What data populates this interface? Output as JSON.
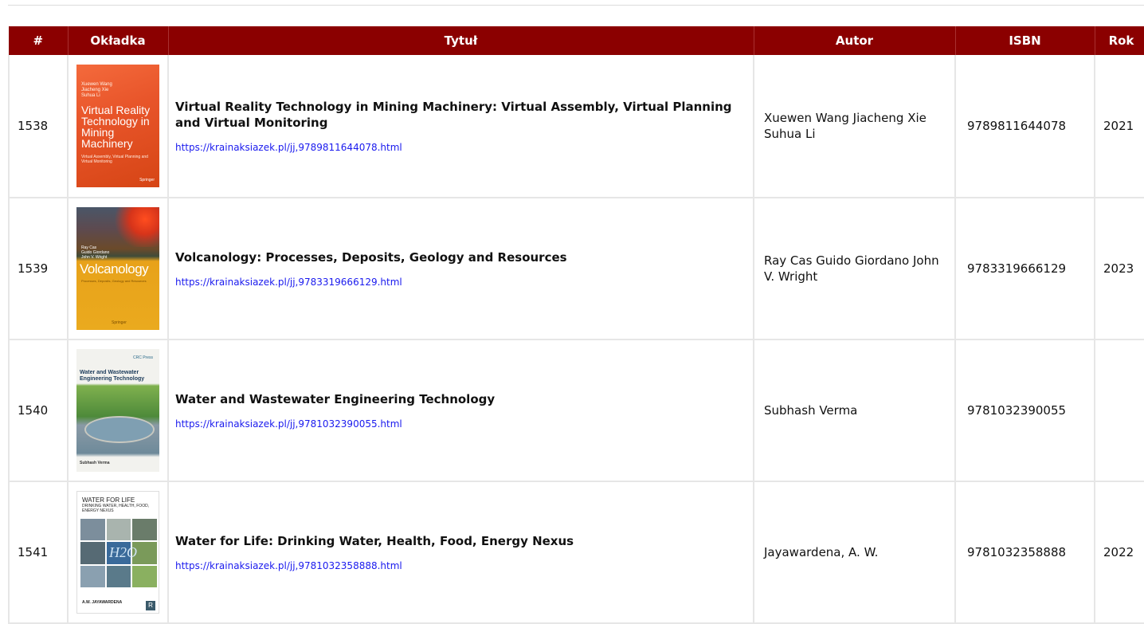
{
  "table": {
    "headers": [
      "#",
      "Okładka",
      "Tytuł",
      "Autor",
      "ISBN",
      "Rok"
    ],
    "rows": [
      {
        "num": "1538",
        "title": "Virtual Reality Technology in Mining Machinery: Virtual Assembly, Virtual Planning and Virtual Monitoring",
        "link": "https://krainaksiazek.pl/jj,9789811644078.html",
        "author": "Xuewen Wang Jiacheng Xie Suhua Li",
        "isbn": "9789811644078",
        "year": "2021",
        "cover": {
          "authors": "Xuewen Wang\nJiacheng Xie\nSuhua Li",
          "title": "Virtual Reality Technology in Mining Machinery",
          "subtitle": "Virtual Assembly, Virtual Planning and Virtual Monitoring",
          "publisher": "Springer"
        }
      },
      {
        "num": "1539",
        "title": "Volcanology: Processes, Deposits, Geology and Resources",
        "link": "https://krainaksiazek.pl/jj,9783319666129.html",
        "author": "Ray Cas Guido Giordano John V. Wright",
        "isbn": "9783319666129",
        "year": "2023",
        "cover": {
          "authors": "Ray Cas\nGuido Giordano\nJohn V. Wright",
          "title": "Volcanology",
          "subtitle": "Processes, Deposits, Geology and Resources",
          "publisher": "Springer"
        }
      },
      {
        "num": "1540",
        "title": "Water and Wastewater Engineering Technology",
        "link": "https://krainaksiazek.pl/jj,9781032390055.html",
        "author": "Subhash Verma",
        "isbn": "9781032390055",
        "year": "",
        "cover": {
          "logo": "CRC Press",
          "title": "Water and Wastewater Engineering Technology",
          "author": "Subhash Verma"
        }
      },
      {
        "num": "1541",
        "title": "Water for Life: Drinking Water, Health, Food, Energy Nexus",
        "link": "https://krainaksiazek.pl/jj,9781032358888.html",
        "author": "Jayawardena, A. W.",
        "isbn": "9781032358888",
        "year": "2022",
        "cover": {
          "title": "WATER FOR LIFE",
          "subtitle": "DRINKING WATER, HEALTH, FOOD, ENERGY NEXUS",
          "h2o": "H2O",
          "author": "A.W. JAYAWARDENA",
          "publisher_mark": "R"
        }
      }
    ]
  },
  "colors": {
    "header_bg": "#8b0000",
    "header_text": "#ffffff",
    "link": "#1a1aee",
    "border": "#e6e6e6"
  }
}
